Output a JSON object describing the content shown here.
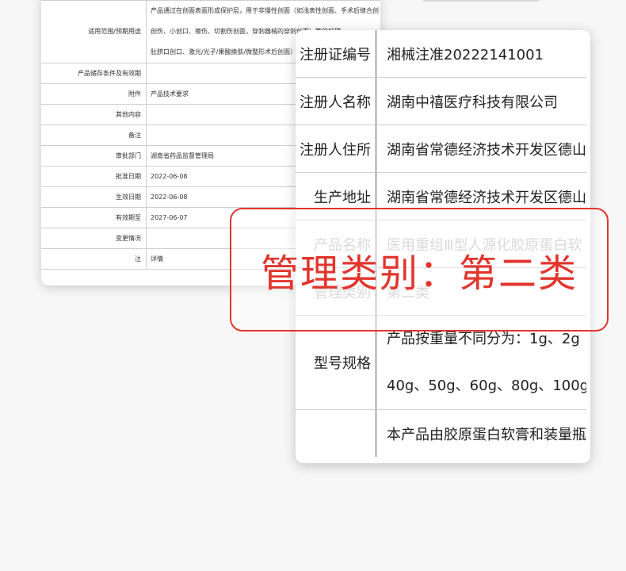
{
  "back_table": {
    "rows": [
      {
        "label": "适用范围/预期用途",
        "lines": [
          "产品通过在创面表面形成保护层，用于非慢性创面（如浅表性创面、手术后缝合创",
          "创伤、小创口、擦伤、切割伤创面，穿刺器械的穿刺创面）等的护理",
          "肚脐口创口、激光/光子/果酸换肤/微整形术后创面）"
        ]
      },
      {
        "label": "产品储存条件及有效期",
        "value": ""
      },
      {
        "label": "附件",
        "value": "产品技术要求"
      },
      {
        "label": "其他内容",
        "value": ""
      },
      {
        "label": "备注",
        "value": ""
      },
      {
        "label": "审批部门",
        "value": "湖南省药品监督管理局"
      },
      {
        "label": "批准日期",
        "value": "2022-06-08"
      },
      {
        "label": "生效日期",
        "value": "2022-06-08"
      },
      {
        "label": "有效期至",
        "value": "2027-06-07"
      },
      {
        "label": "变更情况",
        "value": ""
      },
      {
        "label": "注",
        "value": "详情"
      }
    ]
  },
  "front_table": {
    "rows": [
      {
        "label": "注册证编号",
        "value": "湘械注准20222141001"
      },
      {
        "label": "注册人名称",
        "value": "湖南中禧医疗科技有限公司"
      },
      {
        "label": "注册人住所",
        "value": "湖南省常德经济技术开发区德山"
      },
      {
        "label": "生产地址",
        "value": "湖南省常德经济技术开发区德山"
      },
      {
        "label": "产品名称",
        "value": "医用重组Ⅲ型人源化胶原蛋白软"
      },
      {
        "label": "管理类别",
        "value": "第二类"
      },
      {
        "label": "型号规格",
        "lines": [
          "产品按重量不同分为：1g、2g",
          "40g、50g、60g、80g、100g"
        ]
      },
      {
        "label": "",
        "value": "本产品由胶原蛋白软膏和装量瓶"
      }
    ]
  },
  "overlay": {
    "text": "管理类别：第二类",
    "color": "#e1352d"
  }
}
